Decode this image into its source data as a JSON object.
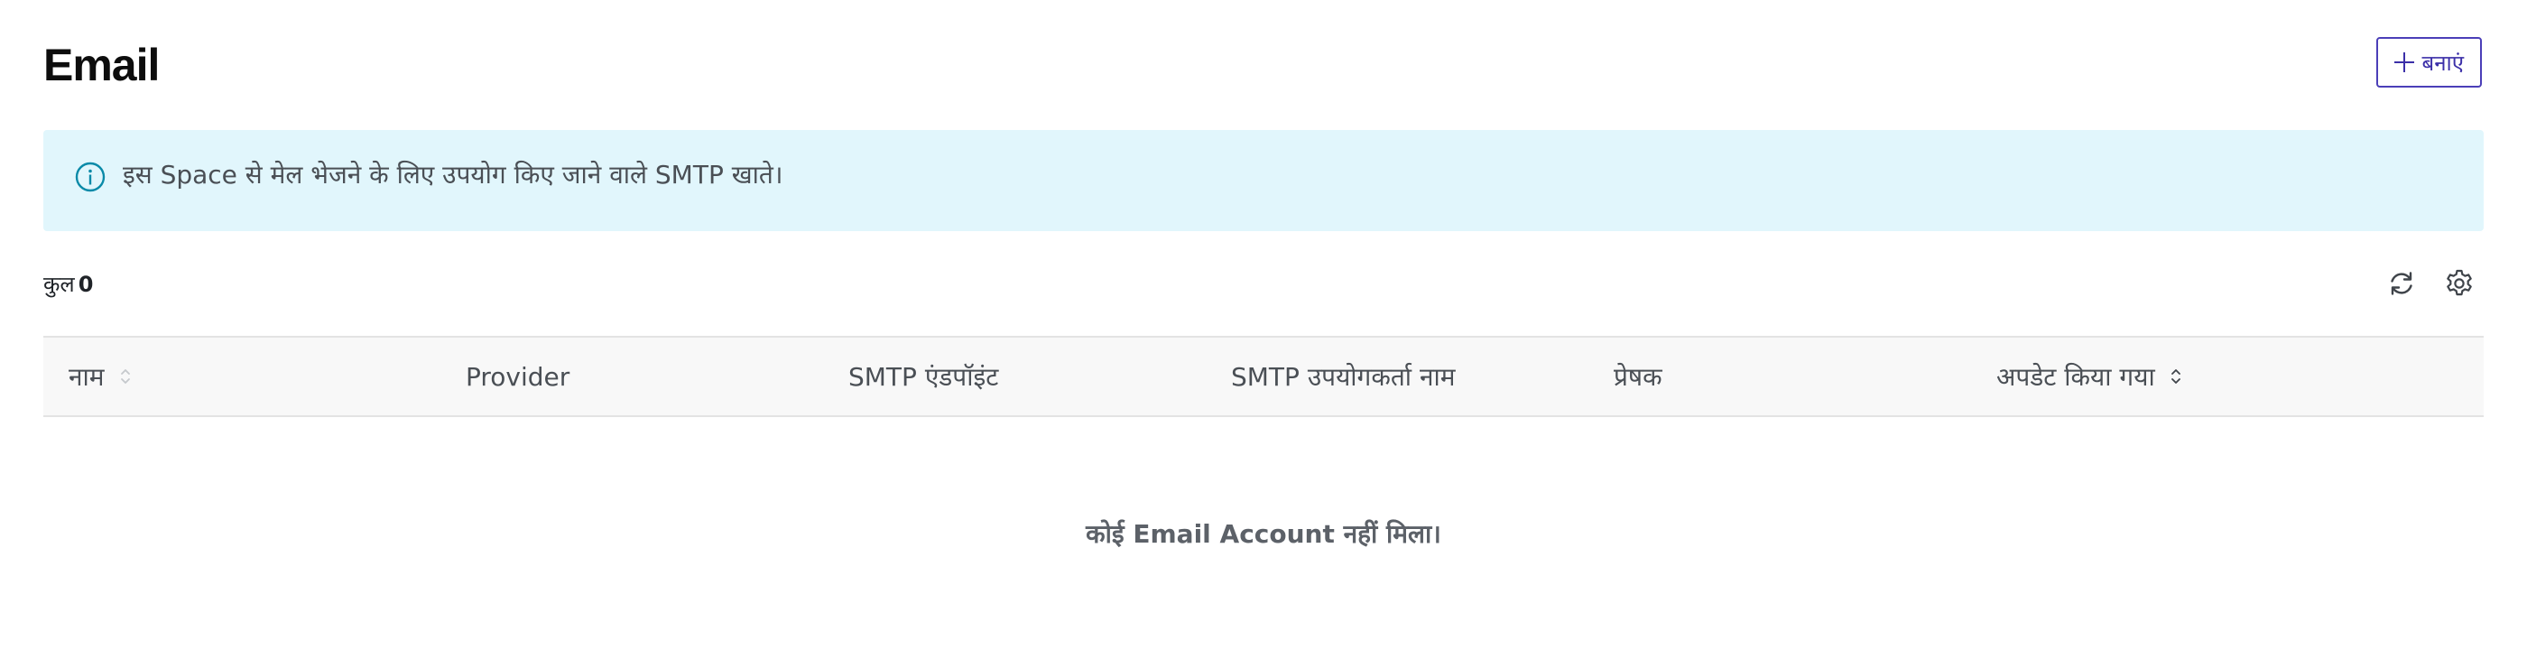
{
  "page": {
    "title": "Email",
    "create_label": "बनाएं"
  },
  "banner": {
    "text": "इस Space से मेल भेजने के लिए उपयोग किए जाने वाले SMTP खाते।",
    "icon": "info-icon"
  },
  "toolbar": {
    "total_label": "कुल",
    "total_count": "0",
    "icons": [
      "refresh-icon",
      "gear-icon"
    ]
  },
  "table": {
    "columns": [
      {
        "label": "नाम",
        "sortable": true,
        "sort_state": "none"
      },
      {
        "label": "Provider",
        "sortable": false
      },
      {
        "label": "SMTP एंडपॉइंट",
        "sortable": false
      },
      {
        "label": "SMTP उपयोगकर्ता नाम",
        "sortable": false
      },
      {
        "label": "प्रेषक",
        "sortable": false
      },
      {
        "label": "अपडेट किया गया",
        "sortable": true,
        "sort_state": "active"
      }
    ],
    "rows": [],
    "empty_message": "कोई Email Account नहीं मिला।"
  },
  "colors": {
    "accent": "#3b2fa8",
    "banner_bg": "#e1f6fc",
    "info_icon": "#0a8aa8",
    "header_bg": "#f8f8f8"
  }
}
